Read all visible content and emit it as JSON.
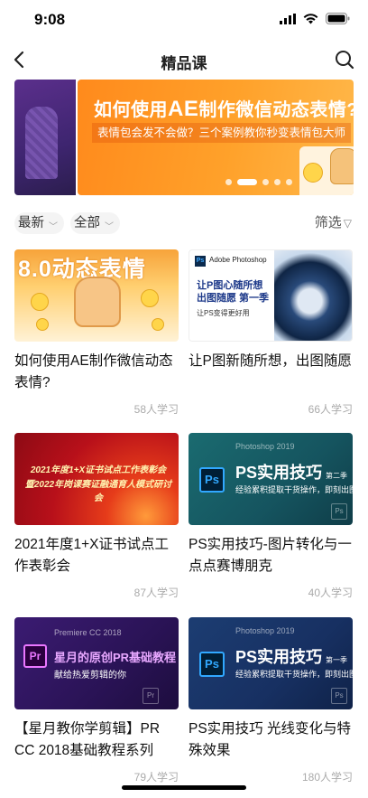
{
  "status_bar": {
    "time": "9:08"
  },
  "nav": {
    "title": "精品课"
  },
  "banner": {
    "title_prefix": "如何使用",
    "title_big": "AE",
    "title_suffix": "制作微信动态表情?",
    "subtitle": "表情包会发不会做？三个案例教你秒变表情包大师",
    "dots": 5,
    "active_dot": 1
  },
  "filters": {
    "sort": "最新",
    "category": "全部",
    "filter_label": "筛选"
  },
  "courses": [
    {
      "title": "如何使用AE制作微信动态表情?",
      "learners": "58人学习",
      "thumb": {
        "headline": "8.0动态表情"
      }
    },
    {
      "title": "让P图新随所想，出图随愿",
      "learners": "66人学习",
      "thumb": {
        "brand": "Adobe Photoshop",
        "ps": "Ps",
        "line1": "让P图心随所想",
        "line2": "出图随愿 第一季",
        "line3": "让PS变得更好用"
      }
    },
    {
      "title": "2021年度1+X证书试点工作表彰会",
      "learners": "87人学习",
      "thumb": {
        "line1": "2021年度1+X证书试点工作表彰会",
        "line2": "暨2022年岗课赛证融通育人模式研讨会"
      }
    },
    {
      "title": "PS实用技巧-图片转化与一点点赛博朋克",
      "learners": "40人学习",
      "thumb": {
        "small": "Photoshop 2019",
        "ps": "Ps",
        "big": "PS实用技巧",
        "ep": "第二季",
        "sub": "经验累积提取干货操作，即刻出图"
      }
    },
    {
      "title": "【星月教你学剪辑】PR CC 2018基础教程系列",
      "learners": "79人学习",
      "thumb": {
        "small": "Premiere CC 2018",
        "pr": "Pr",
        "big": "星月的原创PR基础教程",
        "sub": "献给热爱剪辑的你"
      }
    },
    {
      "title": "PS实用技巧 光线变化与特殊效果",
      "learners": "180人学习",
      "thumb": {
        "small": "Photoshop 2019",
        "ps": "Ps",
        "big": "PS实用技巧",
        "ep": "第一季",
        "sub": "经验累积提取干货操作，即刻出图"
      }
    }
  ]
}
